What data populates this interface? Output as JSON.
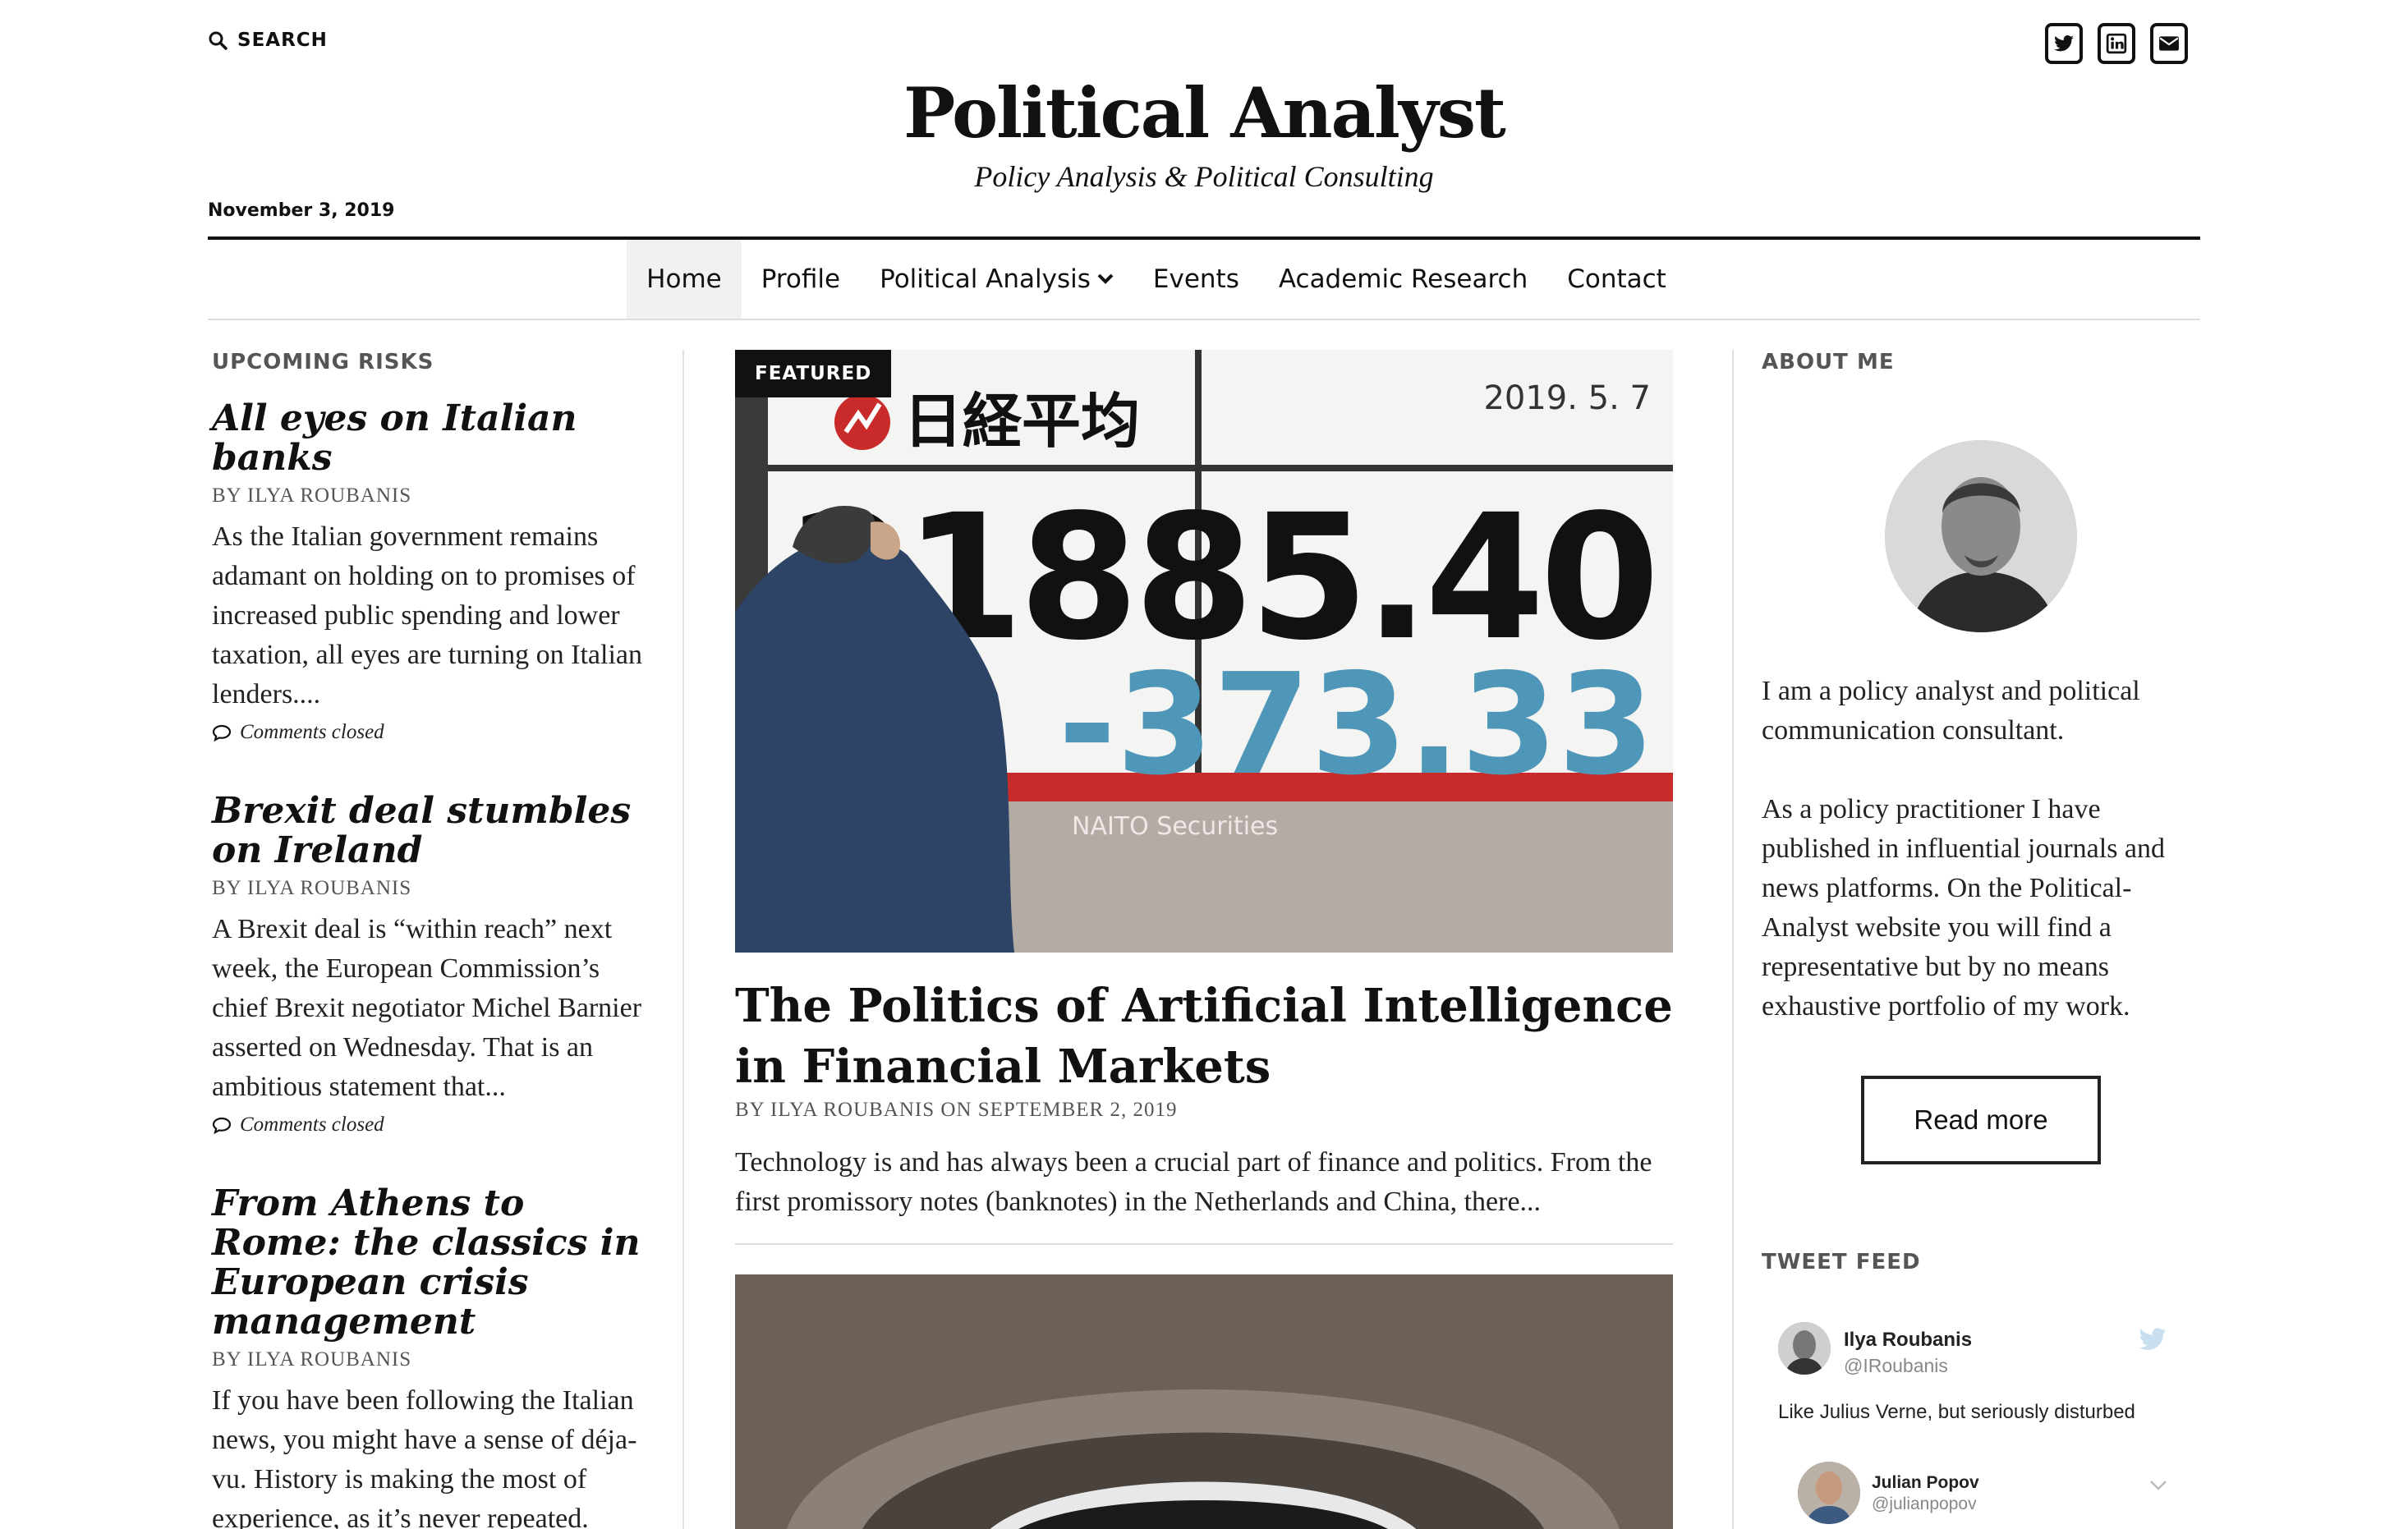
{
  "header": {
    "search_label": "SEARCH",
    "site_title": "Political Analyst",
    "tagline": "Policy Analysis & Political Consulting",
    "date": "November 3, 2019",
    "social_icons": [
      "twitter-icon",
      "linkedin-icon",
      "email-icon"
    ]
  },
  "nav": {
    "items": [
      {
        "label": "Home",
        "active": true
      },
      {
        "label": "Profile"
      },
      {
        "label": "Political Analysis",
        "has_dropdown": true
      },
      {
        "label": "Events"
      },
      {
        "label": "Academic Research"
      },
      {
        "label": "Contact"
      }
    ]
  },
  "left": {
    "title": "UPCOMING RISKS",
    "posts": [
      {
        "title": "All eyes on Italian banks",
        "byline": "BY ILYA ROUBANIS",
        "excerpt": "As the Italian government remains adamant on holding on to promises of increased public spending and lower taxation, all eyes are turning on Italian lenders....",
        "comments": "Comments closed"
      },
      {
        "title": "Brexit deal stumbles on Ireland",
        "byline": "BY ILYA ROUBANIS",
        "excerpt": "A Brexit deal is “within reach” next week, the European Commission’s chief Brexit negotiator Michel Barnier asserted on Wednesday. That is an ambitious statement that...",
        "comments": "Comments closed"
      },
      {
        "title": "From Athens to Rome: the classics in European crisis management",
        "byline": "BY ILYA ROUBANIS",
        "excerpt": "If you have been following the Italian news, you might have a sense of déja-vu. History is making the most of experience, as it’s never repeated. When..."
      }
    ]
  },
  "featured": {
    "badge": "FEATURED",
    "image_text": {
      "index_name": "日経平均",
      "date": "2019. 5. 7",
      "value": "21885.40",
      "change": "-373.33",
      "sponsor": "NAITO Securities"
    },
    "title": "The Politics of Artificial Intelligence in Financial Markets",
    "meta": "BY ILYA ROUBANIS ON SEPTEMBER 2, 2019",
    "excerpt": "Technology is and has always been a crucial part of finance and politics. From the first promissory notes (banknotes) in the Netherlands and China, there..."
  },
  "right": {
    "about_title": "ABOUT ME",
    "about_p1": "I am a policy analyst and political communication consultant.",
    "about_p2": "As a policy practitioner I have published in influential journals and news platforms. On the Political-Analyst website you will find a representative but by no means exhaustive portfolio of my work.",
    "read_more": "Read more",
    "tweet_title": "TWEET FEED",
    "tweet1": {
      "name": "Ilya Roubanis",
      "handle": "@IRoubanis",
      "text": "Like Julius Verne, but seriously disturbed"
    },
    "tweet2": {
      "name": "Julian Popov",
      "handle": "@julianpopov"
    }
  },
  "colors": {
    "text": "#111111",
    "muted": "#555555",
    "nav_active_bg": "#f1f1f1",
    "ticker_red": "#c92a2a",
    "ticker_blue": "#4f97b8"
  }
}
